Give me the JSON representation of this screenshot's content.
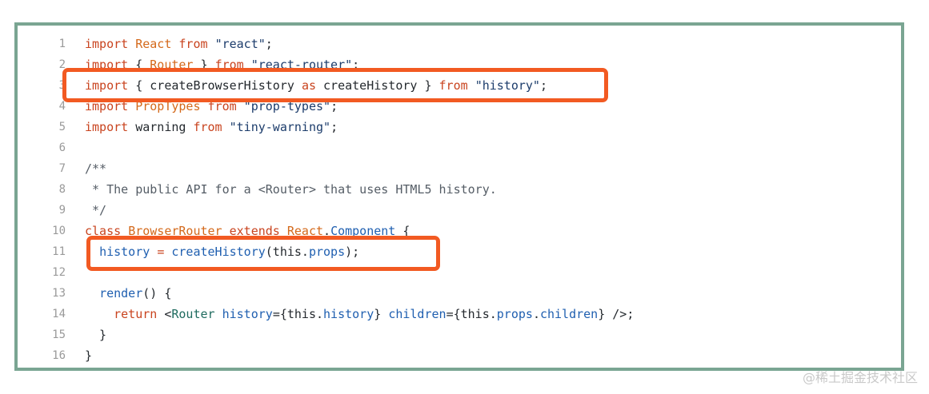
{
  "code": {
    "lines": [
      {
        "n": "1",
        "tokens": [
          {
            "t": "import",
            "c": "kw"
          },
          {
            "t": " "
          },
          {
            "t": "React",
            "c": "ty"
          },
          {
            "t": " "
          },
          {
            "t": "from",
            "c": "kw"
          },
          {
            "t": " "
          },
          {
            "t": "\"react\"",
            "c": "str"
          },
          {
            "t": ";"
          }
        ]
      },
      {
        "n": "2",
        "tokens": [
          {
            "t": "import",
            "c": "kw"
          },
          {
            "t": " { "
          },
          {
            "t": "Router",
            "c": "ty"
          },
          {
            "t": " } "
          },
          {
            "t": "from",
            "c": "kw"
          },
          {
            "t": " "
          },
          {
            "t": "\"react-router\"",
            "c": "str"
          },
          {
            "t": ";"
          }
        ]
      },
      {
        "n": "3",
        "tokens": [
          {
            "t": "import",
            "c": "kw"
          },
          {
            "t": " { createBrowserHistory "
          },
          {
            "t": "as",
            "c": "kw"
          },
          {
            "t": " createHistory } "
          },
          {
            "t": "from",
            "c": "kw"
          },
          {
            "t": " "
          },
          {
            "t": "\"history\"",
            "c": "str"
          },
          {
            "t": ";"
          }
        ]
      },
      {
        "n": "4",
        "tokens": [
          {
            "t": "import",
            "c": "kw"
          },
          {
            "t": " "
          },
          {
            "t": "PropTypes",
            "c": "ty"
          },
          {
            "t": " "
          },
          {
            "t": "from",
            "c": "kw"
          },
          {
            "t": " "
          },
          {
            "t": "\"prop-types\"",
            "c": "str"
          },
          {
            "t": ";"
          }
        ]
      },
      {
        "n": "5",
        "tokens": [
          {
            "t": "import",
            "c": "kw"
          },
          {
            "t": " warning "
          },
          {
            "t": "from",
            "c": "kw"
          },
          {
            "t": " "
          },
          {
            "t": "\"tiny-warning\"",
            "c": "str"
          },
          {
            "t": ";"
          }
        ]
      },
      {
        "n": "6",
        "tokens": []
      },
      {
        "n": "7",
        "tokens": [
          {
            "t": "/**",
            "c": "cm"
          }
        ]
      },
      {
        "n": "8",
        "tokens": [
          {
            "t": " * The public API for a <Router> that uses HTML5 history.",
            "c": "cm"
          }
        ]
      },
      {
        "n": "9",
        "tokens": [
          {
            "t": " */",
            "c": "cm"
          }
        ]
      },
      {
        "n": "10",
        "tokens": [
          {
            "t": "class",
            "c": "kw"
          },
          {
            "t": " "
          },
          {
            "t": "BrowserRouter",
            "c": "ty"
          },
          {
            "t": " "
          },
          {
            "t": "extends",
            "c": "kw"
          },
          {
            "t": " "
          },
          {
            "t": "React",
            "c": "ty"
          },
          {
            "t": "."
          },
          {
            "t": "Component",
            "c": "prop"
          },
          {
            "t": " {"
          }
        ]
      },
      {
        "n": "11",
        "tokens": [
          {
            "t": "  "
          },
          {
            "t": "history",
            "c": "prop"
          },
          {
            "t": " "
          },
          {
            "t": "=",
            "c": "kw"
          },
          {
            "t": " "
          },
          {
            "t": "createHistory",
            "c": "prop"
          },
          {
            "t": "(this."
          },
          {
            "t": "props",
            "c": "prop"
          },
          {
            "t": ");"
          }
        ]
      },
      {
        "n": "12",
        "tokens": []
      },
      {
        "n": "13",
        "tokens": [
          {
            "t": "  "
          },
          {
            "t": "render",
            "c": "prop"
          },
          {
            "t": "() {"
          }
        ]
      },
      {
        "n": "14",
        "tokens": [
          {
            "t": "    "
          },
          {
            "t": "return",
            "c": "kw"
          },
          {
            "t": " <"
          },
          {
            "t": "Router",
            "c": "tag"
          },
          {
            "t": " "
          },
          {
            "t": "history",
            "c": "prop"
          },
          {
            "t": "={this."
          },
          {
            "t": "history",
            "c": "prop"
          },
          {
            "t": "} "
          },
          {
            "t": "children",
            "c": "prop"
          },
          {
            "t": "={this."
          },
          {
            "t": "props",
            "c": "prop"
          },
          {
            "t": "."
          },
          {
            "t": "children",
            "c": "prop"
          },
          {
            "t": "} />;"
          }
        ]
      },
      {
        "n": "15",
        "tokens": [
          {
            "t": "  }"
          }
        ]
      },
      {
        "n": "16",
        "tokens": [
          {
            "t": "}"
          }
        ]
      }
    ]
  },
  "highlights": [
    {
      "line": "3"
    },
    {
      "line": "11"
    }
  ],
  "watermark": "@稀土掘金技术社区",
  "colors": {
    "frame_border": "#7aa592",
    "highlight_box": "#f25a22",
    "keyword": "#c9441f",
    "type": "#d4691b",
    "string": "#1c3c6b",
    "property": "#1f5fb0",
    "tag": "#1f6b5f",
    "comment": "#555d66",
    "line_number": "#9a9a9a"
  }
}
